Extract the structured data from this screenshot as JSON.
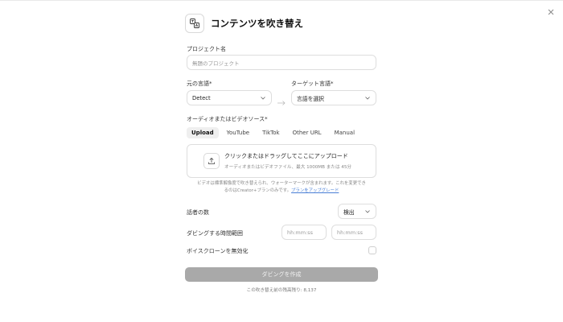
{
  "dialog": {
    "title": "コンテンツを吹き替え",
    "header_icon": "translate-icon",
    "close_icon": "close-icon"
  },
  "project_name": {
    "label": "プロジェクト名",
    "placeholder": "無題のプロジェクト"
  },
  "source_language": {
    "label": "元の言語",
    "required_mark": "*",
    "value": "Detect"
  },
  "target_language": {
    "label": "ターゲット言語",
    "required_mark": "*",
    "value": "言語を選択"
  },
  "arrow_icon": "arrow-right-icon",
  "source": {
    "label": "オーディオまたはビデオソース",
    "required_mark": "*",
    "tabs": [
      "Upload",
      "YouTube",
      "TikTok",
      "Other URL",
      "Manual"
    ],
    "active_tab": "Upload"
  },
  "upload": {
    "icon": "upload-icon",
    "title": "クリックまたはドラッグしてここにアップロード",
    "subtitle": "オーディオまたはビデオファイル、最大 1000MB または 45分"
  },
  "notice": {
    "text_line1": "ビデオは標準解像度で吹き替えられ、ウォーターマークが含まれます。これを変更でき",
    "text_line2": "るのはCreator+プランのみです。",
    "link": "プランをアップグレード"
  },
  "speakers": {
    "label": "話者の数",
    "value": "検出"
  },
  "time_range": {
    "label": "ダビングする時間範囲",
    "start_placeholder": "hh:mm:ss",
    "end_placeholder": "hh:mm:ss"
  },
  "voice_clone": {
    "label": "ボイスクローンを無効化",
    "checked": false
  },
  "submit": {
    "label": "ダビングを作成"
  },
  "footer": {
    "remaining": "この吹き替え前の残高残り: 8,137"
  },
  "colors": {
    "submit_bg": "#a9a9a9",
    "link": "#4a7fd6",
    "border": "#dedede"
  }
}
